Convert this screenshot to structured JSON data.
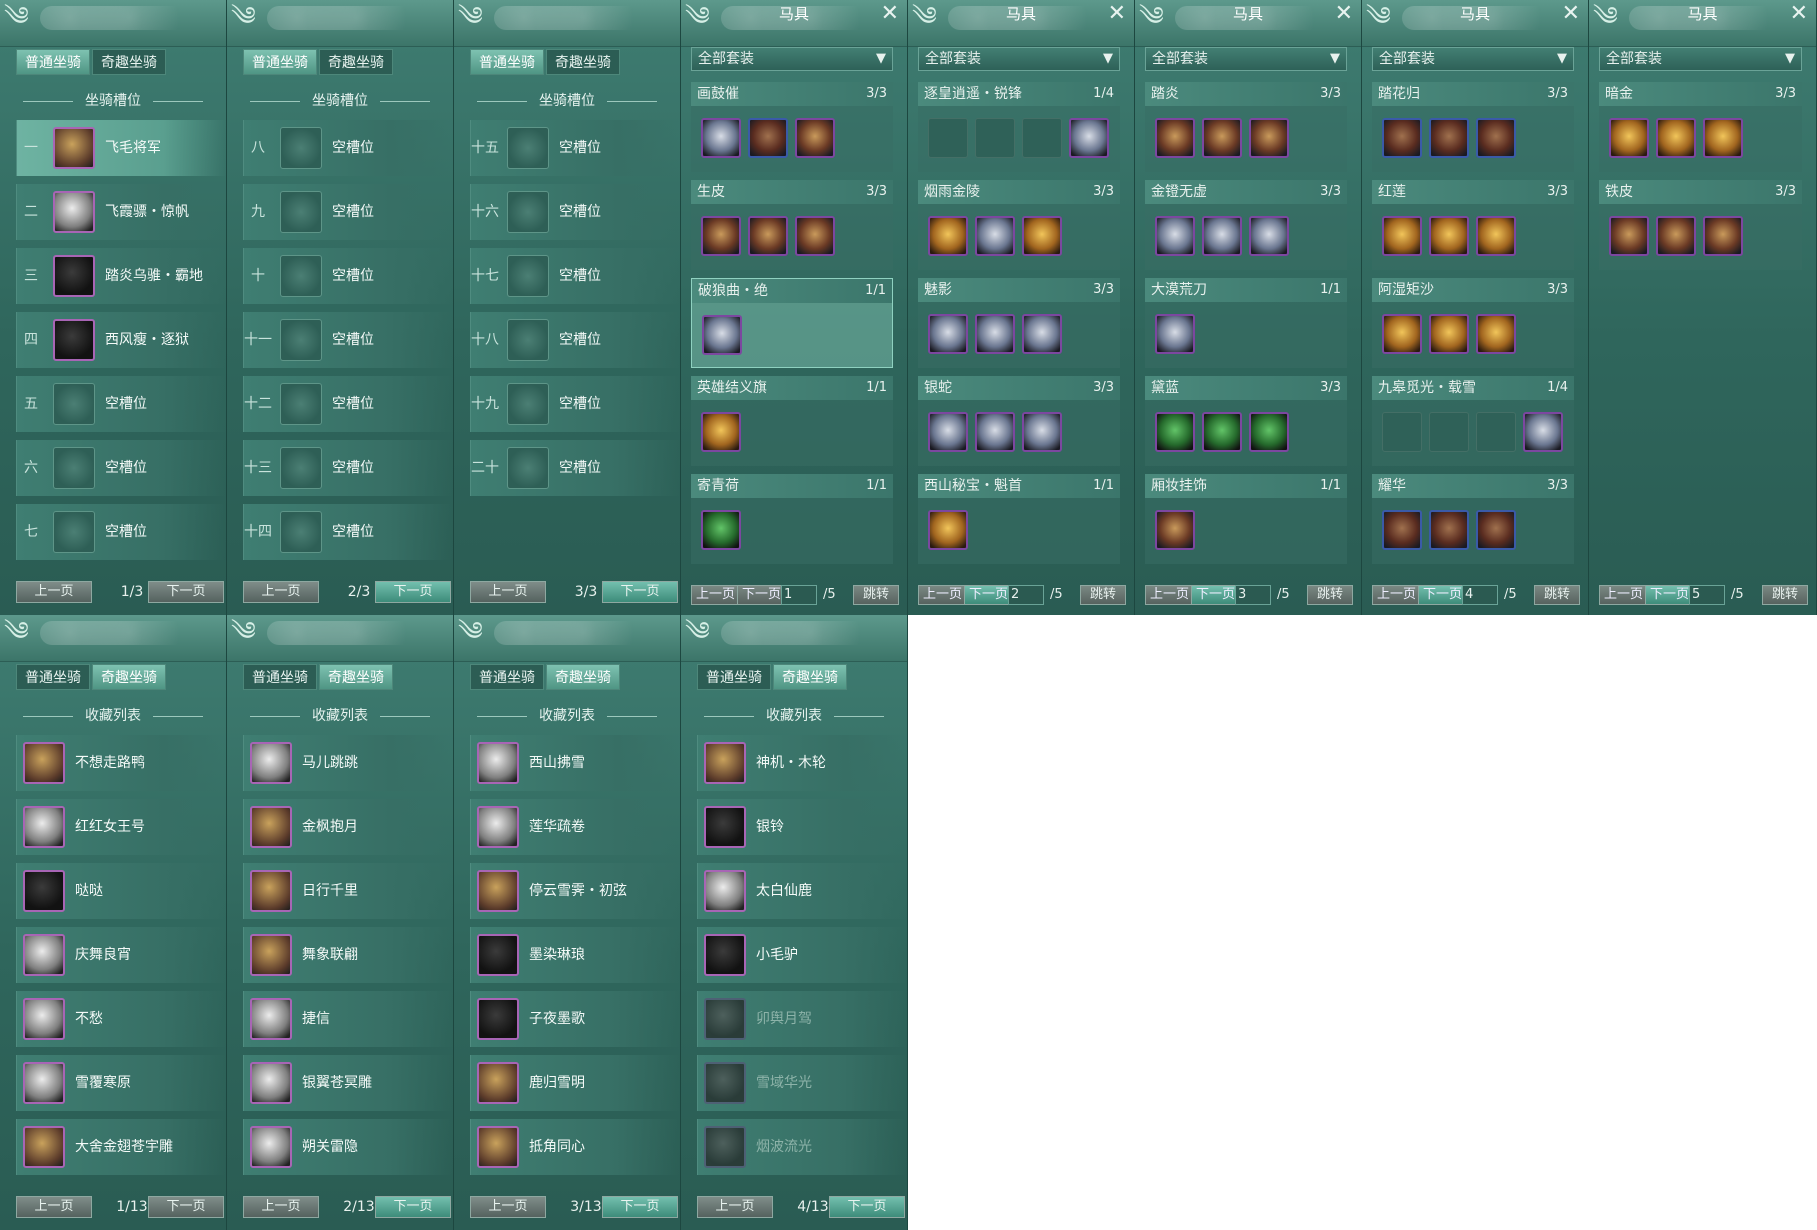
{
  "mount_tabs": [
    "普通坐骑",
    "奇趣坐骑"
  ],
  "mount_slot_heading": "坐骑槽位",
  "collection_heading": "收藏列表",
  "prev": "上一页",
  "next": "下一页",
  "slot_panels": [
    {
      "page": "1/3",
      "rows": [
        {
          "n": "一",
          "name": "飞毛将军",
          "t": "gold",
          "sel": true
        },
        {
          "n": "二",
          "name": "飞霞骠・惊帆",
          "t": "b"
        },
        {
          "n": "三",
          "name": "踏炎乌骓・霸地",
          "t": "k"
        },
        {
          "n": "四",
          "name": "西风瘦・逐狱",
          "t": "k"
        },
        {
          "n": "五",
          "name": "空槽位",
          "t": "empty"
        },
        {
          "n": "六",
          "name": "空槽位",
          "t": "empty"
        },
        {
          "n": "七",
          "name": "空槽位",
          "t": "empty"
        }
      ]
    },
    {
      "page": "2/3",
      "rows": [
        {
          "n": "八",
          "name": "空槽位",
          "t": "empty"
        },
        {
          "n": "九",
          "name": "空槽位",
          "t": "empty"
        },
        {
          "n": "十",
          "name": "空槽位",
          "t": "empty"
        },
        {
          "n": "十一",
          "name": "空槽位",
          "t": "empty"
        },
        {
          "n": "十二",
          "name": "空槽位",
          "t": "empty"
        },
        {
          "n": "十三",
          "name": "空槽位",
          "t": "empty"
        },
        {
          "n": "十四",
          "name": "空槽位",
          "t": "empty"
        }
      ]
    },
    {
      "page": "3/3",
      "rows": [
        {
          "n": "十五",
          "name": "空槽位",
          "t": "empty"
        },
        {
          "n": "十六",
          "name": "空槽位",
          "t": "empty"
        },
        {
          "n": "十七",
          "name": "空槽位",
          "t": "empty"
        },
        {
          "n": "十八",
          "name": "空槽位",
          "t": "empty"
        },
        {
          "n": "十九",
          "name": "空槽位",
          "t": "empty"
        },
        {
          "n": "二十",
          "name": "空槽位",
          "t": "empty"
        },
        {
          "n": "",
          "name": "",
          "t": "none"
        }
      ]
    }
  ],
  "harness_title": "马具",
  "harness_filter": "全部套装",
  "jump_label": "跳转",
  "harness_panels": [
    {
      "page": "1",
      "total": "/5",
      "sets": [
        {
          "name": "画鼓催",
          "count": "3/3",
          "items": [
            "s",
            "blue",
            "c"
          ]
        },
        {
          "name": "生皮",
          "count": "3/3",
          "items": [
            "c",
            "c",
            "c"
          ]
        },
        {
          "name": "破狼曲・绝",
          "count": "1/1",
          "items": [
            "s"
          ],
          "sel": true
        },
        {
          "name": "英雄结义旗",
          "count": "1/1",
          "items": [
            "y"
          ]
        },
        {
          "name": "寄青荷",
          "count": "1/1",
          "items": [
            "g"
          ]
        }
      ]
    },
    {
      "page": "2",
      "total": "/5",
      "sets": [
        {
          "name": "逐皇逍遥・锐锋",
          "count": "1/4",
          "items": [
            "slot",
            "slot",
            "slot",
            "s"
          ]
        },
        {
          "name": "烟雨金陵",
          "count": "3/3",
          "items": [
            "y",
            "s",
            "y"
          ]
        },
        {
          "name": "魅影",
          "count": "3/3",
          "items": [
            "s",
            "s",
            "s"
          ]
        },
        {
          "name": "银蛇",
          "count": "3/3",
          "items": [
            "s",
            "s",
            "s"
          ]
        },
        {
          "name": "西山秘宝・魁首",
          "count": "1/1",
          "items": [
            "y"
          ]
        }
      ]
    },
    {
      "page": "3",
      "total": "/5",
      "sets": [
        {
          "name": "踏炎",
          "count": "3/3",
          "items": [
            "c",
            "c",
            "c"
          ]
        },
        {
          "name": "金镫无虚",
          "count": "3/3",
          "items": [
            "s",
            "s",
            "s"
          ]
        },
        {
          "name": "大漠荒刀",
          "count": "1/1",
          "items": [
            "s"
          ]
        },
        {
          "name": "黛蓝",
          "count": "3/3",
          "items": [
            "g",
            "g",
            "g"
          ]
        },
        {
          "name": "厢妆挂饰",
          "count": "1/1",
          "items": [
            "c"
          ]
        }
      ]
    },
    {
      "page": "4",
      "total": "/5",
      "sets": [
        {
          "name": "踏花归",
          "count": "3/3",
          "items": [
            "blue",
            "blue",
            "blue"
          ]
        },
        {
          "name": "红莲",
          "count": "3/3",
          "items": [
            "y",
            "y",
            "y"
          ]
        },
        {
          "name": "阿湿矩沙",
          "count": "3/3",
          "items": [
            "y",
            "y",
            "y"
          ]
        },
        {
          "name": "九皋觅光・载雪",
          "count": "1/4",
          "items": [
            "slot",
            "slot",
            "slot",
            "s"
          ]
        },
        {
          "name": "耀华",
          "count": "3/3",
          "items": [
            "blue",
            "blue",
            "blue"
          ]
        }
      ]
    },
    {
      "page": "5",
      "total": "/5",
      "sets": [
        {
          "name": "暗金",
          "count": "3/3",
          "items": [
            "y",
            "y",
            "y"
          ]
        },
        {
          "name": "铁皮",
          "count": "3/3",
          "items": [
            "c",
            "c",
            "c"
          ]
        }
      ]
    }
  ],
  "collection_panels": [
    {
      "page": "1/13",
      "rows": [
        {
          "name": "不想走路鸭",
          "t": "gold"
        },
        {
          "name": "红红女王号",
          "t": "b"
        },
        {
          "name": "哒哒",
          "t": "k"
        },
        {
          "name": "庆舞良宵",
          "t": "b"
        },
        {
          "name": "不愁",
          "t": "b"
        },
        {
          "name": "雪覆寒原",
          "t": "b"
        },
        {
          "name": "大舍金翅苍宇雕",
          "t": "gold"
        }
      ]
    },
    {
      "page": "2/13",
      "rows": [
        {
          "name": "马儿跳跳",
          "t": "b"
        },
        {
          "name": "金枫抱月",
          "t": "gold"
        },
        {
          "name": "日行千里",
          "t": "gold"
        },
        {
          "name": "舞象联翩",
          "t": "gold"
        },
        {
          "name": "捷信",
          "t": "b"
        },
        {
          "name": "银翼苍冥雕",
          "t": "b"
        },
        {
          "name": "朔关雷隐",
          "t": "b"
        }
      ]
    },
    {
      "page": "3/13",
      "rows": [
        {
          "name": "西山拂雪",
          "t": "b"
        },
        {
          "name": "莲华疏卷",
          "t": "b"
        },
        {
          "name": "停云雪霁・初弦",
          "t": "gold"
        },
        {
          "name": "墨染琳琅",
          "t": "k"
        },
        {
          "name": "子夜墨歌",
          "t": "k"
        },
        {
          "name": "鹿归雪明",
          "t": "gold"
        },
        {
          "name": "抵角同心",
          "t": "gold"
        }
      ]
    },
    {
      "page": "4/13",
      "rows": [
        {
          "name": "神机・木轮",
          "t": "gold"
        },
        {
          "name": "银铃",
          "t": "k"
        },
        {
          "name": "太白仙鹿",
          "t": "b"
        },
        {
          "name": "小毛驴",
          "t": "k"
        },
        {
          "name": "卯舆月驾",
          "t": "dim"
        },
        {
          "name": "雪域华光",
          "t": "dim"
        },
        {
          "name": "烟波流光",
          "t": "dim"
        }
      ]
    }
  ]
}
